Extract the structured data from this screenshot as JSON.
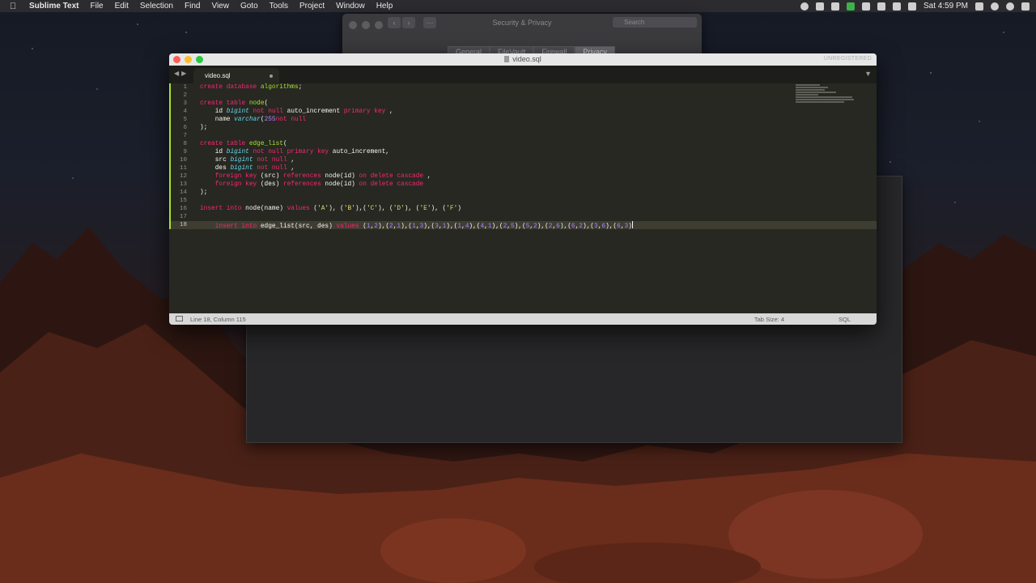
{
  "menubar": {
    "app": "Sublime Text",
    "items": [
      "File",
      "Edit",
      "Selection",
      "Find",
      "View",
      "Goto",
      "Tools",
      "Project",
      "Window",
      "Help"
    ],
    "clock": "Sat 4:59 PM"
  },
  "security_window": {
    "title": "Security & Privacy",
    "search_placeholder": "Search",
    "tabs": [
      "General",
      "FileVault",
      "Firewall",
      "Privacy"
    ],
    "selected_tab": "Privacy"
  },
  "sublime": {
    "window_title": "video.sql",
    "unregistered": "UNREGISTERED",
    "tab_label": "video.sql",
    "line_numbers": [
      "1",
      "2",
      "3",
      "4",
      "5",
      "6",
      "7",
      "8",
      "9",
      "10",
      "11",
      "12",
      "13",
      "14",
      "15",
      "16",
      "17",
      "18"
    ],
    "current_line": "18",
    "status": {
      "position": "Line 18, Column 115",
      "tab_size": "Tab Size: 4",
      "syntax": "SQL"
    }
  },
  "colors": {
    "keyword": "#f92672",
    "identifier": "#a6e22e",
    "type": "#66d9ef",
    "string": "#e6db74",
    "number": "#ae81ff",
    "editor_bg": "#272822"
  }
}
